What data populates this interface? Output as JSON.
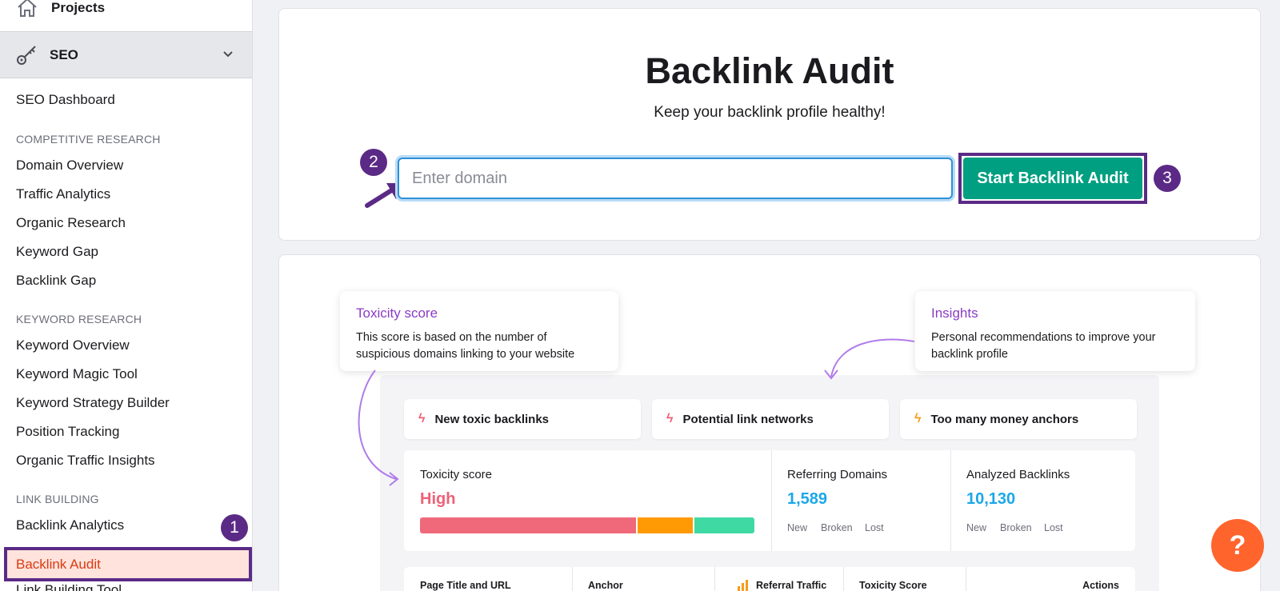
{
  "sidebar": {
    "projects_label": "Projects",
    "seo_label": "SEO",
    "dashboard": "SEO Dashboard",
    "sections": [
      {
        "title": "COMPETITIVE RESEARCH",
        "items": [
          "Domain Overview",
          "Traffic Analytics",
          "Organic Research",
          "Keyword Gap",
          "Backlink Gap"
        ]
      },
      {
        "title": "KEYWORD RESEARCH",
        "items": [
          "Keyword Overview",
          "Keyword Magic Tool",
          "Keyword Strategy Builder",
          "Position Tracking",
          "Organic Traffic Insights"
        ]
      },
      {
        "title": "LINK BUILDING",
        "items": [
          "Backlink Analytics",
          "Backlink Audit",
          "Link Building Tool"
        ]
      }
    ]
  },
  "steps": {
    "one": "1",
    "two": "2",
    "three": "3"
  },
  "main": {
    "title": "Backlink Audit",
    "subtitle": "Keep your backlink profile healthy!",
    "domain_placeholder": "Enter domain",
    "start_button": "Start Backlink Audit"
  },
  "preview": {
    "tips": {
      "toxicity_title": "Toxicity score",
      "toxicity_desc": "This score is based on the number of suspicious domains linking to your website",
      "insights_title": "Insights",
      "insights_desc": "Personal recommendations to improve your backlink profile"
    },
    "issues": [
      "New toxic backlinks",
      "Potential link networks",
      "Too many money anchors"
    ],
    "toxicity": {
      "label": "Toxicity score",
      "value": "High"
    },
    "referring": {
      "label": "Referring Domains",
      "value": "1,589",
      "subs": [
        "New",
        "Broken",
        "Lost"
      ]
    },
    "backlinks": {
      "label": "Analyzed Backlinks",
      "value": "10,130",
      "subs": [
        "New",
        "Broken",
        "Lost"
      ]
    },
    "table_headers": [
      "Page Title and URL",
      "Anchor",
      "Referral Traffic",
      "Toxicity Score",
      "Actions"
    ]
  },
  "help_label": "?",
  "colors": {
    "brand_purple": "#5b2a86",
    "start_green": "#009f81",
    "active_bg": "#ffe3dc",
    "active_text": "#d93b14",
    "high_red": "#ef6176",
    "metric_blue": "#1ba7e8",
    "help_orange": "#ff642d"
  }
}
